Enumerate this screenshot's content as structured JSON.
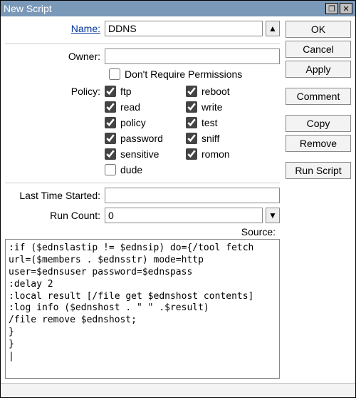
{
  "window": {
    "title": "New Script"
  },
  "labels": {
    "name": "Name:",
    "owner": "Owner:",
    "dont_require": "Don't Require Permissions",
    "policy": "Policy:",
    "last_time": "Last Time Started:",
    "run_count": "Run Count:",
    "source": "Source:"
  },
  "fields": {
    "name": "DDNS",
    "owner": "",
    "last_time": "",
    "run_count": "0",
    "dont_require_checked": false
  },
  "policy": [
    {
      "key": "ftp",
      "label": "ftp",
      "checked": true
    },
    {
      "key": "reboot",
      "label": "reboot",
      "checked": true
    },
    {
      "key": "read",
      "label": "read",
      "checked": true
    },
    {
      "key": "write",
      "label": "write",
      "checked": true
    },
    {
      "key": "policy",
      "label": "policy",
      "checked": true
    },
    {
      "key": "test",
      "label": "test",
      "checked": true
    },
    {
      "key": "password",
      "label": "password",
      "checked": true
    },
    {
      "key": "sniff",
      "label": "sniff",
      "checked": true
    },
    {
      "key": "sensitive",
      "label": "sensitive",
      "checked": true
    },
    {
      "key": "romon",
      "label": "romon",
      "checked": true
    },
    {
      "key": "dude",
      "label": "dude",
      "checked": false
    }
  ],
  "source": ":if ($ednslastip != $ednsip) do={/tool fetch url=($members . $ednsstr) mode=http user=$ednsuser password=$ednspass\n:delay 2\n:local result [/file get $ednshost contents]\n:log info ($ednshost . \" \" .$result)\n/file remove $ednshost;\n}\n}\n|",
  "buttons": {
    "ok": "OK",
    "cancel": "Cancel",
    "apply": "Apply",
    "comment": "Comment",
    "copy": "Copy",
    "remove": "Remove",
    "run": "Run Script"
  },
  "icons": {
    "up": "▲",
    "down": "▼",
    "restore": "❐",
    "close": "✕"
  }
}
